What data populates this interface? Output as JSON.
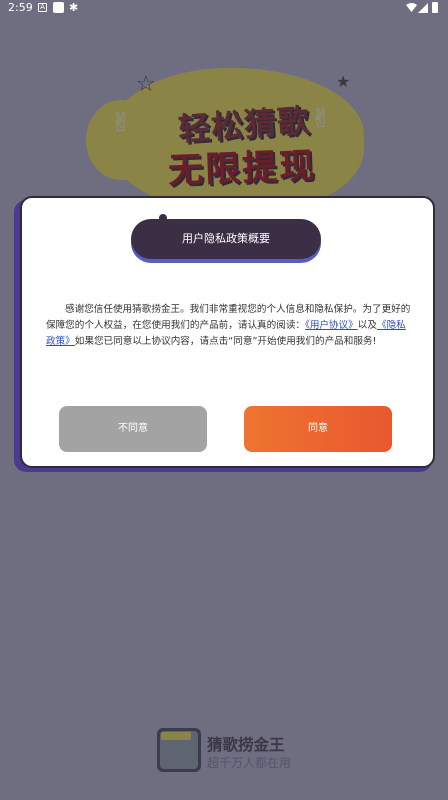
{
  "status_bar": {
    "time": "2:59",
    "icons": [
      "a-icon",
      "square-icon",
      "bug-icon",
      "wifi-icon",
      "signal-icon",
      "battery-icon"
    ]
  },
  "banner": {
    "line1": "轻松猜歌",
    "line2": "无限提现"
  },
  "dialog": {
    "title": "用户隐私政策概要",
    "body_intro": "感谢您信任使用猜歌捞金王。我们非常重视您的个人信息和隐私保护。为了更好的保障您的个人权益，在您使用我们的产品前，请认真的阅读：",
    "user_agreement_link": "《用户协议》",
    "and_text": "以及",
    "privacy_policy_link": "《隐私政策》",
    "body_outro": "如果您已同意以上协议内容，请点击“同意”开始使用我们的产品和服务!",
    "disagree_label": "不同意",
    "agree_label": "同意"
  },
  "brand": {
    "name": "猜歌捞金王",
    "slogan": "超千万人都在用"
  },
  "colors": {
    "background": "#6f6e80",
    "dialog_title_bg": "#3a2f45",
    "agree_button": "#ef7430",
    "disagree_button": "#a3a3a3",
    "link": "#2b4fc2"
  }
}
